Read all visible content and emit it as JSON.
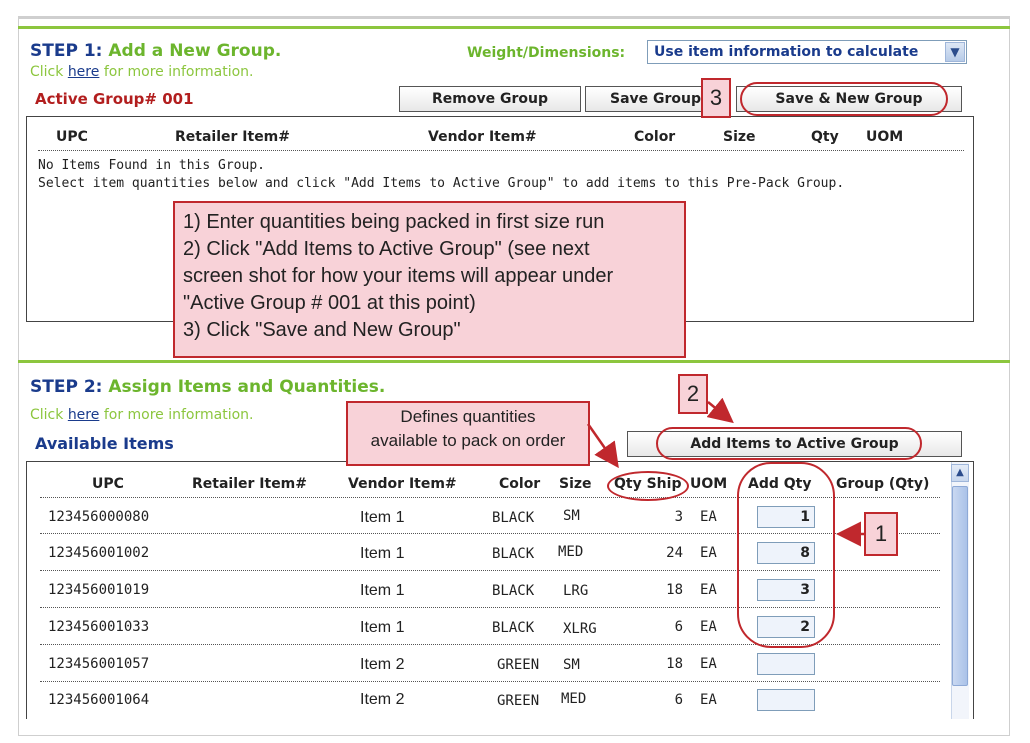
{
  "step1": {
    "title_prefix": "STEP 1:",
    "title_text": "Add a New Group.",
    "click_pre": "Click",
    "click_link": "here",
    "click_post": "for more information.",
    "weight_label": "Weight/Dimensions:",
    "weight_value": "Use item information to calculate",
    "active_group": "Active Group# 001",
    "buttons": {
      "remove": "Remove Group",
      "save": "Save Group",
      "save_new": "Save & New Group"
    },
    "columns": [
      "UPC",
      "Retailer Item#",
      "Vendor Item#",
      "Color",
      "Size",
      "Qty",
      "UOM"
    ],
    "empty_line1": "No Items Found in this Group.",
    "empty_line2": "Select item quantities below and click \"Add Items to Active Group\" to add items to this Pre-Pack Group."
  },
  "step2": {
    "title_prefix": "STEP 2:",
    "title_text": "Assign Items and Quantities.",
    "click_pre": "Click",
    "click_link": "here",
    "click_post": "for more information.",
    "available_label": "Available Items",
    "add_button": "Add Items to Active Group",
    "columns": [
      "UPC",
      "Retailer Item#",
      "Vendor Item#",
      "Color",
      "Size",
      "Qty Ship",
      "UOM",
      "Add Qty",
      "Group (Qty)"
    ],
    "rows": [
      {
        "upc": "123456000080",
        "vendor": "Item 1",
        "color": "BLACK",
        "size": "SM",
        "qty_ship": "3",
        "uom": "EA",
        "add_qty": "1"
      },
      {
        "upc": "123456001002",
        "vendor": "Item 1",
        "color": "BLACK",
        "size": "MED",
        "qty_ship": "24",
        "uom": "EA",
        "add_qty": "8"
      },
      {
        "upc": "123456001019",
        "vendor": "Item 1",
        "color": "BLACK",
        "size": "LRG",
        "qty_ship": "18",
        "uom": "EA",
        "add_qty": "3"
      },
      {
        "upc": "123456001033",
        "vendor": "Item 1",
        "color": "BLACK",
        "size": "XLRG",
        "qty_ship": "6",
        "uom": "EA",
        "add_qty": "2"
      },
      {
        "upc": "123456001057",
        "vendor": "Item 2",
        "color": "GREEN",
        "size": "SM",
        "qty_ship": "18",
        "uom": "EA",
        "add_qty": ""
      },
      {
        "upc": "123456001064",
        "vendor": "Item 2",
        "color": "GREEN",
        "size": "MED",
        "qty_ship": "6",
        "uom": "EA",
        "add_qty": ""
      }
    ]
  },
  "annotations": {
    "instructions": {
      "line1": "1) Enter quantities being packed in first size run",
      "line2": "2) Click \"Add Items to Active Group\" (see next",
      "line3": "screen shot for how your items will appear under",
      "line4": "\"Active Group # 001 at this point)",
      "line5": "3) Click \"Save and New Group\""
    },
    "defines_line1": "Defines quantities",
    "defines_line2": "available to pack on order",
    "tag1": "1",
    "tag2": "2",
    "tag3": "3"
  },
  "colors": {
    "accent_green": "#6cb52d",
    "brand_blue": "#1a3b8c",
    "annotation_red": "#c0282d",
    "annotation_fill": "#f8d2d8"
  }
}
